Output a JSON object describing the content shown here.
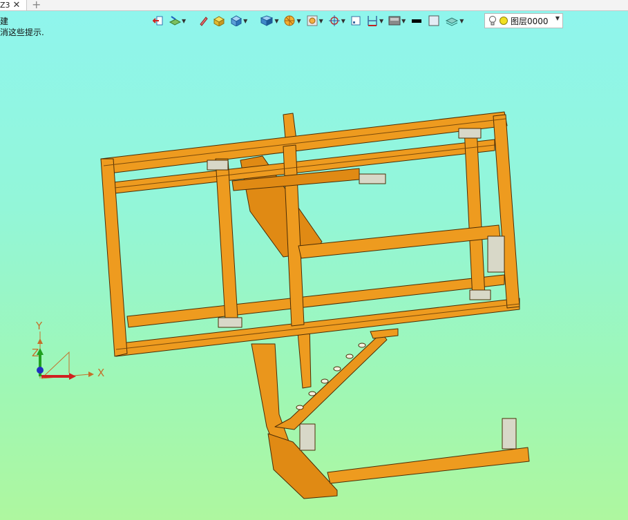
{
  "tab": {
    "title": "Z3",
    "close": "✕",
    "add": "+"
  },
  "hint": {
    "line1": "建",
    "line2": "消这些提示."
  },
  "toolbar": {
    "icons": [
      "exit-sketch-icon",
      "plane-icon",
      "pencil-icon",
      "block-icon",
      "cube-icon",
      "shaded-cube-icon",
      "render-icon",
      "view-icon",
      "orient-icon",
      "frame-icon",
      "measure-icon",
      "display-icon",
      "color-fill-icon",
      "color-box-icon",
      "layer-stack-icon"
    ],
    "layer": {
      "value": "图层0000"
    }
  },
  "axes": {
    "x": "X",
    "y": "Y",
    "z": "Z"
  },
  "colors": {
    "frame": "#ee9b1f",
    "frame_dark": "#a85e0a",
    "outline": "#4a2c05"
  }
}
